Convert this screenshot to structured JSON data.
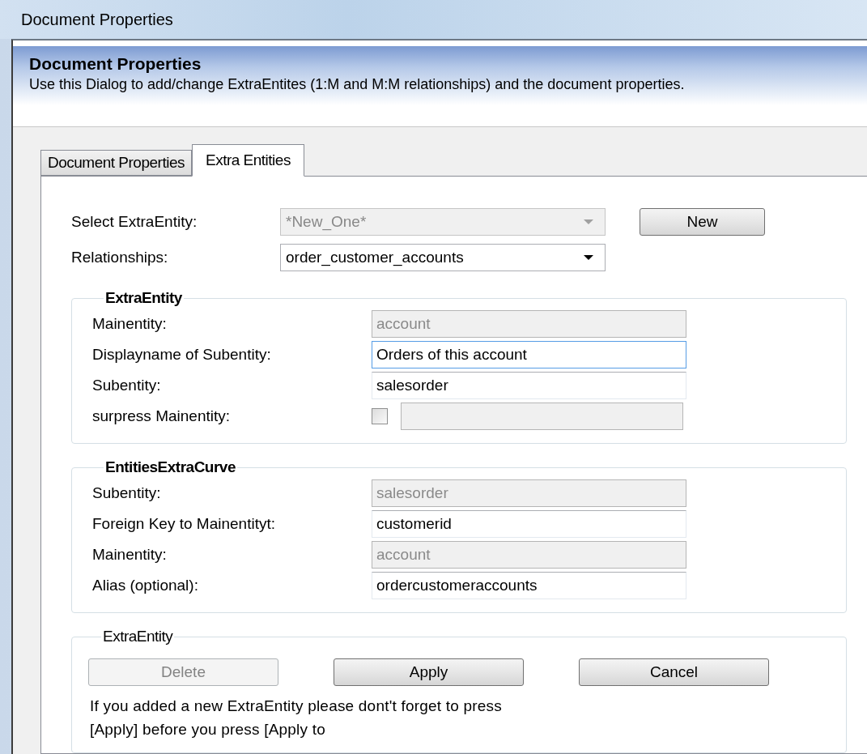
{
  "window": {
    "title": "Document Properties"
  },
  "header": {
    "title": "Document Properties",
    "description": "Use this Dialog to add/change ExtraEntites (1:M and M:M relationships) and the document properties."
  },
  "tabs": [
    {
      "label": "Document Properties",
      "selected": false
    },
    {
      "label": "Extra Entities",
      "selected": true
    }
  ],
  "top_fields": [
    {
      "label": "Select ExtraEntity:",
      "value": "*New_One*",
      "disabled": true
    },
    {
      "label": "Relationships:",
      "value": "order_customer_accounts",
      "disabled": false
    }
  ],
  "new_button": {
    "label": "New"
  },
  "groups": [
    {
      "title": "ExtraEntity",
      "rows": [
        {
          "kind": "text",
          "label": "Mainentity:",
          "value": "account",
          "disabled": true,
          "focused": false
        },
        {
          "kind": "text",
          "label": "Displayname of Subentity:",
          "value": "Orders of this account",
          "disabled": false,
          "focused": true
        },
        {
          "kind": "text",
          "label": "Subentity:",
          "value": "salesorder",
          "disabled": false,
          "focused": false
        },
        {
          "kind": "checkbox",
          "label": "surpress Mainentity:",
          "checked": false,
          "disabled": true
        }
      ]
    },
    {
      "title": "EntitiesExtraCurve",
      "rows": [
        {
          "kind": "text",
          "label": "Subentity:",
          "value": "salesorder",
          "disabled": true,
          "focused": false
        },
        {
          "kind": "text",
          "label": "Foreign Key to Mainentityt:",
          "value": "customerid",
          "disabled": false,
          "focused": false
        },
        {
          "kind": "text",
          "label": "Mainentity:",
          "value": "account",
          "disabled": true,
          "focused": false
        },
        {
          "kind": "text",
          "label": "Alias (optional):",
          "value": "ordercustomeraccounts",
          "disabled": false,
          "focused": false
        }
      ]
    }
  ],
  "actions": {
    "title": "ExtraEntity",
    "buttons": [
      {
        "label": "Delete",
        "disabled": true
      },
      {
        "label": "Apply",
        "disabled": false
      },
      {
        "label": "Cancel",
        "disabled": false
      }
    ],
    "note": "If you added a new ExtraEntity please dont't forget to press [Apply] before you press [Apply to"
  }
}
